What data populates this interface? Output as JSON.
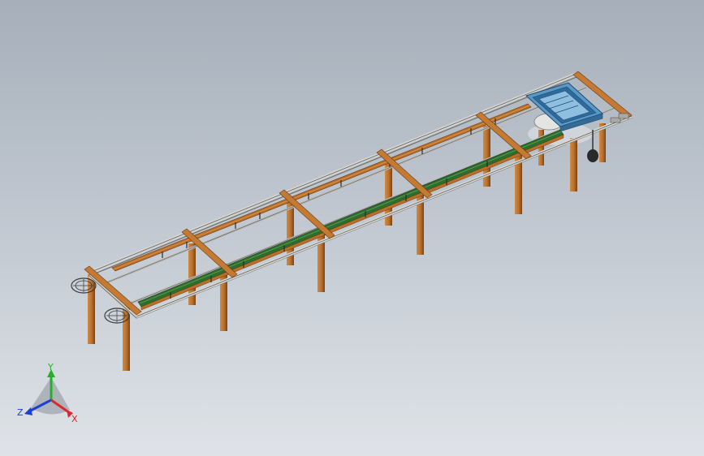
{
  "viewport": {
    "background_top": "#a6afba",
    "background_bottom": "#dfe3e8"
  },
  "model": {
    "frame_color": "#c8c8c4",
    "wood_color": "#b86f2a",
    "wood_dark": "#7a4416",
    "conveyor_color": "#2d6e2d",
    "control_box_color": "#3f7fb0"
  },
  "triad": {
    "x_label": "X",
    "y_label": "Y",
    "z_label": "Z",
    "x_color": "#e0262a",
    "y_color": "#25b02a",
    "z_color": "#1c3fd6",
    "icon": "axis-triad-icon"
  }
}
